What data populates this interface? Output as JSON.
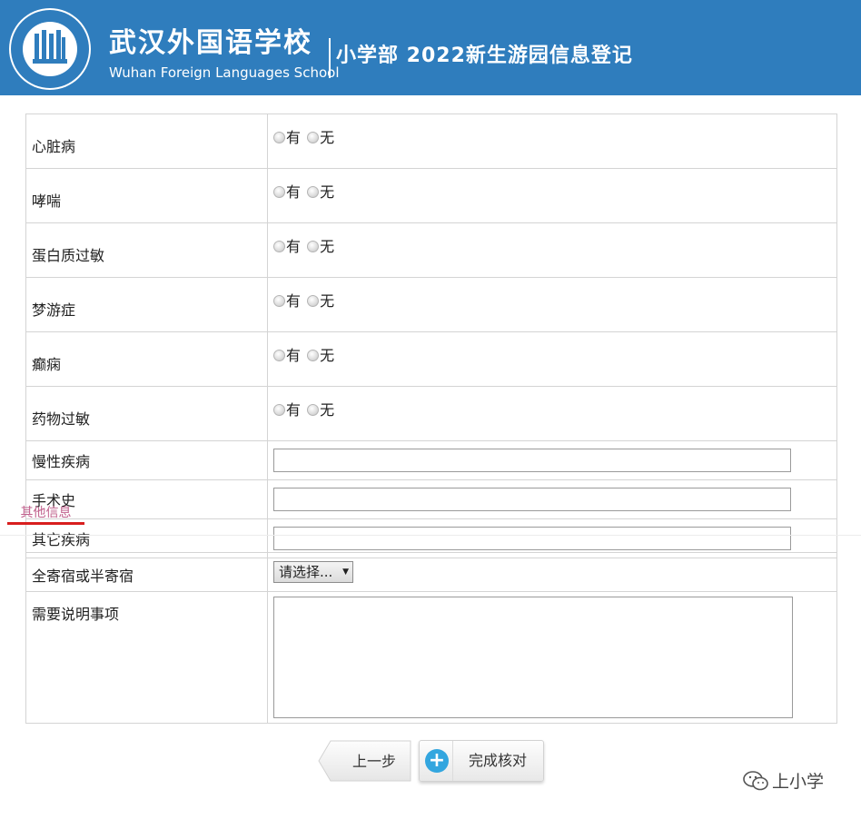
{
  "header": {
    "logo_text": "武汉外国语学校 WUHAN FOREIGN LANGUAGES SCHOOL",
    "school_name_cn": "武汉外国语学校",
    "school_name_en": "Wuhan Foreign Languages School",
    "page_title": "小学部 2022新生游园信息登记",
    "background_color": "#2f7dbd"
  },
  "health": {
    "radio_rows": [
      {
        "label": "心脏病",
        "option_yes": "有",
        "option_no": "无"
      },
      {
        "label": "哮喘",
        "option_yes": "有",
        "option_no": "无"
      },
      {
        "label": "蛋白质过敏",
        "option_yes": "有",
        "option_no": "无"
      },
      {
        "label": "梦游症",
        "option_yes": "有",
        "option_no": "无"
      },
      {
        "label": "癫痫",
        "option_yes": "有",
        "option_no": "无"
      },
      {
        "label": "药物过敏",
        "option_yes": "有",
        "option_no": "无"
      }
    ],
    "text_rows": [
      {
        "label": "慢性疾病",
        "value": ""
      },
      {
        "label": "手术史",
        "value": ""
      },
      {
        "label": "其它疾病",
        "value": ""
      }
    ]
  },
  "other": {
    "section_title": "其他信息",
    "boarding_label": "全寄宿或半寄宿",
    "boarding_select": "请选择...",
    "notes_label": "需要说明事项",
    "notes_value": ""
  },
  "buttons": {
    "prev_label": "上一步",
    "done_label": "完成核对"
  },
  "watermark": {
    "text": "上小学",
    "icon": "wechat-icon"
  },
  "colors": {
    "section_accent": "#d81e1e",
    "section_text": "#c0608c",
    "done_icon": "#33a6df"
  }
}
